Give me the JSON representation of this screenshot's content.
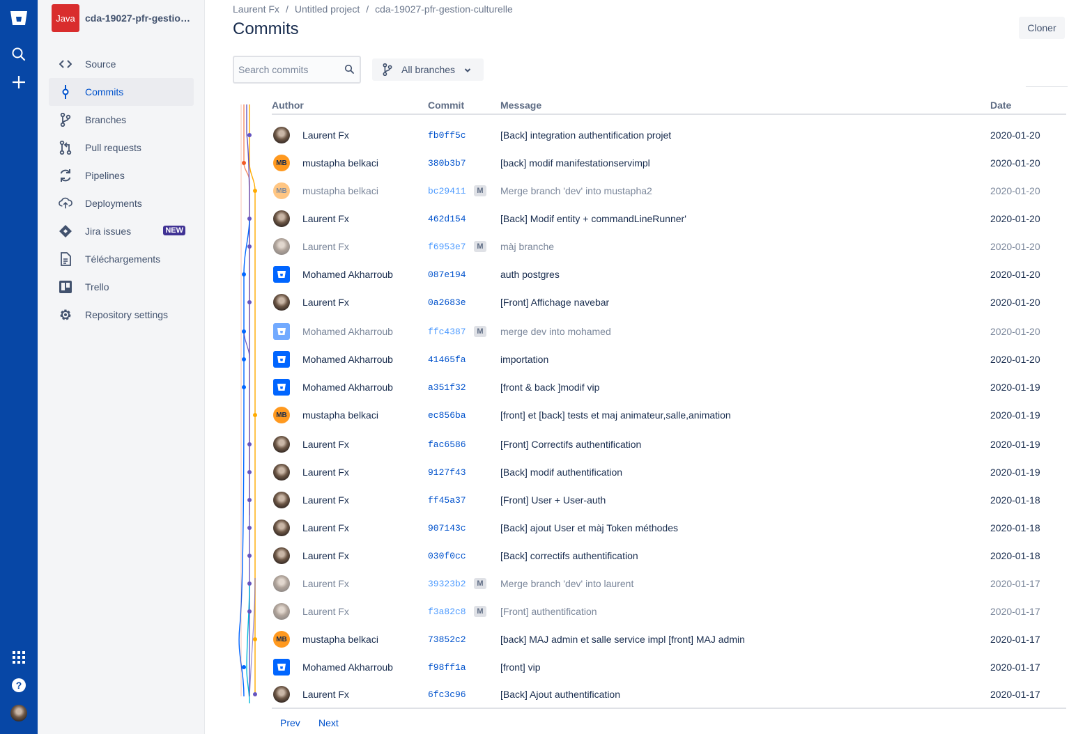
{
  "global_nav": {
    "icons": [
      "bitbucket-logo",
      "search-icon",
      "create-icon",
      "app-switcher-icon",
      "help-icon",
      "profile-avatar"
    ]
  },
  "repo": {
    "avatar_text": "Java",
    "name": "cda-19027-pfr-gestion..."
  },
  "sidebar": {
    "items": [
      {
        "label": "Source",
        "icon": "code-icon"
      },
      {
        "label": "Commits",
        "icon": "commit-icon",
        "active": true
      },
      {
        "label": "Branches",
        "icon": "branch-icon"
      },
      {
        "label": "Pull requests",
        "icon": "pull-request-icon"
      },
      {
        "label": "Pipelines",
        "icon": "pipelines-icon"
      },
      {
        "label": "Deployments",
        "icon": "deployments-icon"
      },
      {
        "label": "Jira issues",
        "icon": "jira-icon",
        "badge": "NEW"
      },
      {
        "label": "Téléchargements",
        "icon": "downloads-icon"
      },
      {
        "label": "Trello",
        "icon": "trello-icon"
      },
      {
        "label": "Repository settings",
        "icon": "gear-icon"
      }
    ]
  },
  "breadcrumbs": [
    "Laurent Fx",
    "Untitled project",
    "cda-19027-pfr-gestion-culturelle"
  ],
  "page_title": "Commits",
  "clone_label": "Cloner",
  "search": {
    "placeholder": "Search commits"
  },
  "branch_filter": {
    "label": "All branches"
  },
  "table": {
    "headers": {
      "author": "Author",
      "commit": "Commit",
      "message": "Message",
      "date": "Date"
    },
    "merge_badge": "M",
    "rows": [
      {
        "author": "Laurent Fx",
        "avatar": "photo",
        "hash": "fb0ff5c",
        "message": "[Back] integration authentification projet",
        "date": "2020-01-20",
        "merge": false
      },
      {
        "author": "mustapha belkaci",
        "avatar": "MB",
        "hash": "380b3b7",
        "message": "[back] modif manifestationservimpl",
        "date": "2020-01-20",
        "merge": false
      },
      {
        "author": "mustapha belkaci",
        "avatar": "MB",
        "hash": "bc29411",
        "message": "Merge branch 'dev' into mustapha2",
        "date": "2020-01-20",
        "merge": true
      },
      {
        "author": "Laurent Fx",
        "avatar": "photo",
        "hash": "462d154",
        "message": "[Back] Modif entity + commandLineRunner'",
        "date": "2020-01-20",
        "merge": false
      },
      {
        "author": "Laurent Fx",
        "avatar": "photo",
        "hash": "f6953e7",
        "message": "màj branche",
        "date": "2020-01-20",
        "merge": true
      },
      {
        "author": "Mohamed Akharroub",
        "avatar": "bitbucket",
        "hash": "087e194",
        "message": "auth postgres",
        "date": "2020-01-20",
        "merge": false
      },
      {
        "author": "Laurent Fx",
        "avatar": "photo",
        "hash": "0a2683e",
        "message": "[Front] Affichage navebar",
        "date": "2020-01-20",
        "merge": false
      },
      {
        "author": "Mohamed Akharroub",
        "avatar": "bitbucket",
        "hash": "ffc4387",
        "message": "merge dev into mohamed",
        "date": "2020-01-20",
        "merge": true
      },
      {
        "author": "Mohamed Akharroub",
        "avatar": "bitbucket",
        "hash": "41465fa",
        "message": "importation",
        "date": "2020-01-20",
        "merge": false
      },
      {
        "author": "Mohamed Akharroub",
        "avatar": "bitbucket",
        "hash": "a351f32",
        "message": "[front & back ]modif vip",
        "date": "2020-01-19",
        "merge": false
      },
      {
        "author": "mustapha belkaci",
        "avatar": "MB",
        "hash": "ec856ba",
        "message": "[front] et [back] tests et maj animateur,salle,animation",
        "date": "2020-01-19",
        "merge": false
      },
      {
        "author": "Laurent Fx",
        "avatar": "photo",
        "hash": "fac6586",
        "message": "[Front] Correctifs authentification",
        "date": "2020-01-19",
        "merge": false
      },
      {
        "author": "Laurent Fx",
        "avatar": "photo",
        "hash": "9127f43",
        "message": "[Back] modif authentification",
        "date": "2020-01-19",
        "merge": false
      },
      {
        "author": "Laurent Fx",
        "avatar": "photo",
        "hash": "ff45a37",
        "message": "[Front] User + User-auth",
        "date": "2020-01-18",
        "merge": false
      },
      {
        "author": "Laurent Fx",
        "avatar": "photo",
        "hash": "907143c",
        "message": "[Back] ajout User et màj Token méthodes",
        "date": "2020-01-18",
        "merge": false
      },
      {
        "author": "Laurent Fx",
        "avatar": "photo",
        "hash": "030f0cc",
        "message": "[Back] correctifs authentification",
        "date": "2020-01-18",
        "merge": false
      },
      {
        "author": "Laurent Fx",
        "avatar": "photo",
        "hash": "39323b2",
        "message": "Merge branch 'dev' into laurent",
        "date": "2020-01-17",
        "merge": true
      },
      {
        "author": "Laurent Fx",
        "avatar": "photo",
        "hash": "f3a82c8",
        "message": "[Front] authentification",
        "date": "2020-01-17",
        "merge": true
      },
      {
        "author": "mustapha belkaci",
        "avatar": "MB",
        "hash": "73852c2",
        "message": "[back] MAJ admin et salle service impl [front] MAJ admin",
        "date": "2020-01-17",
        "merge": false
      },
      {
        "author": "Mohamed Akharroub",
        "avatar": "bitbucket",
        "hash": "f98ff1a",
        "message": "[front] vip",
        "date": "2020-01-17",
        "merge": false
      },
      {
        "author": "Laurent Fx",
        "avatar": "photo",
        "hash": "6fc3c96",
        "message": "[Back] Ajout authentification",
        "date": "2020-01-17",
        "merge": false
      }
    ]
  },
  "pagination": {
    "prev": "Prev",
    "next": "Next"
  },
  "colors": {
    "global_nav_bg": "#0747a6",
    "link_blue": "#0052cc",
    "badge_purple": "#403294",
    "repo_avatar_red": "#d92d2d",
    "graph_lines": [
      "#f15a24",
      "#ffab00",
      "#6554c0",
      "#0065ff",
      "#00b8d9"
    ]
  }
}
